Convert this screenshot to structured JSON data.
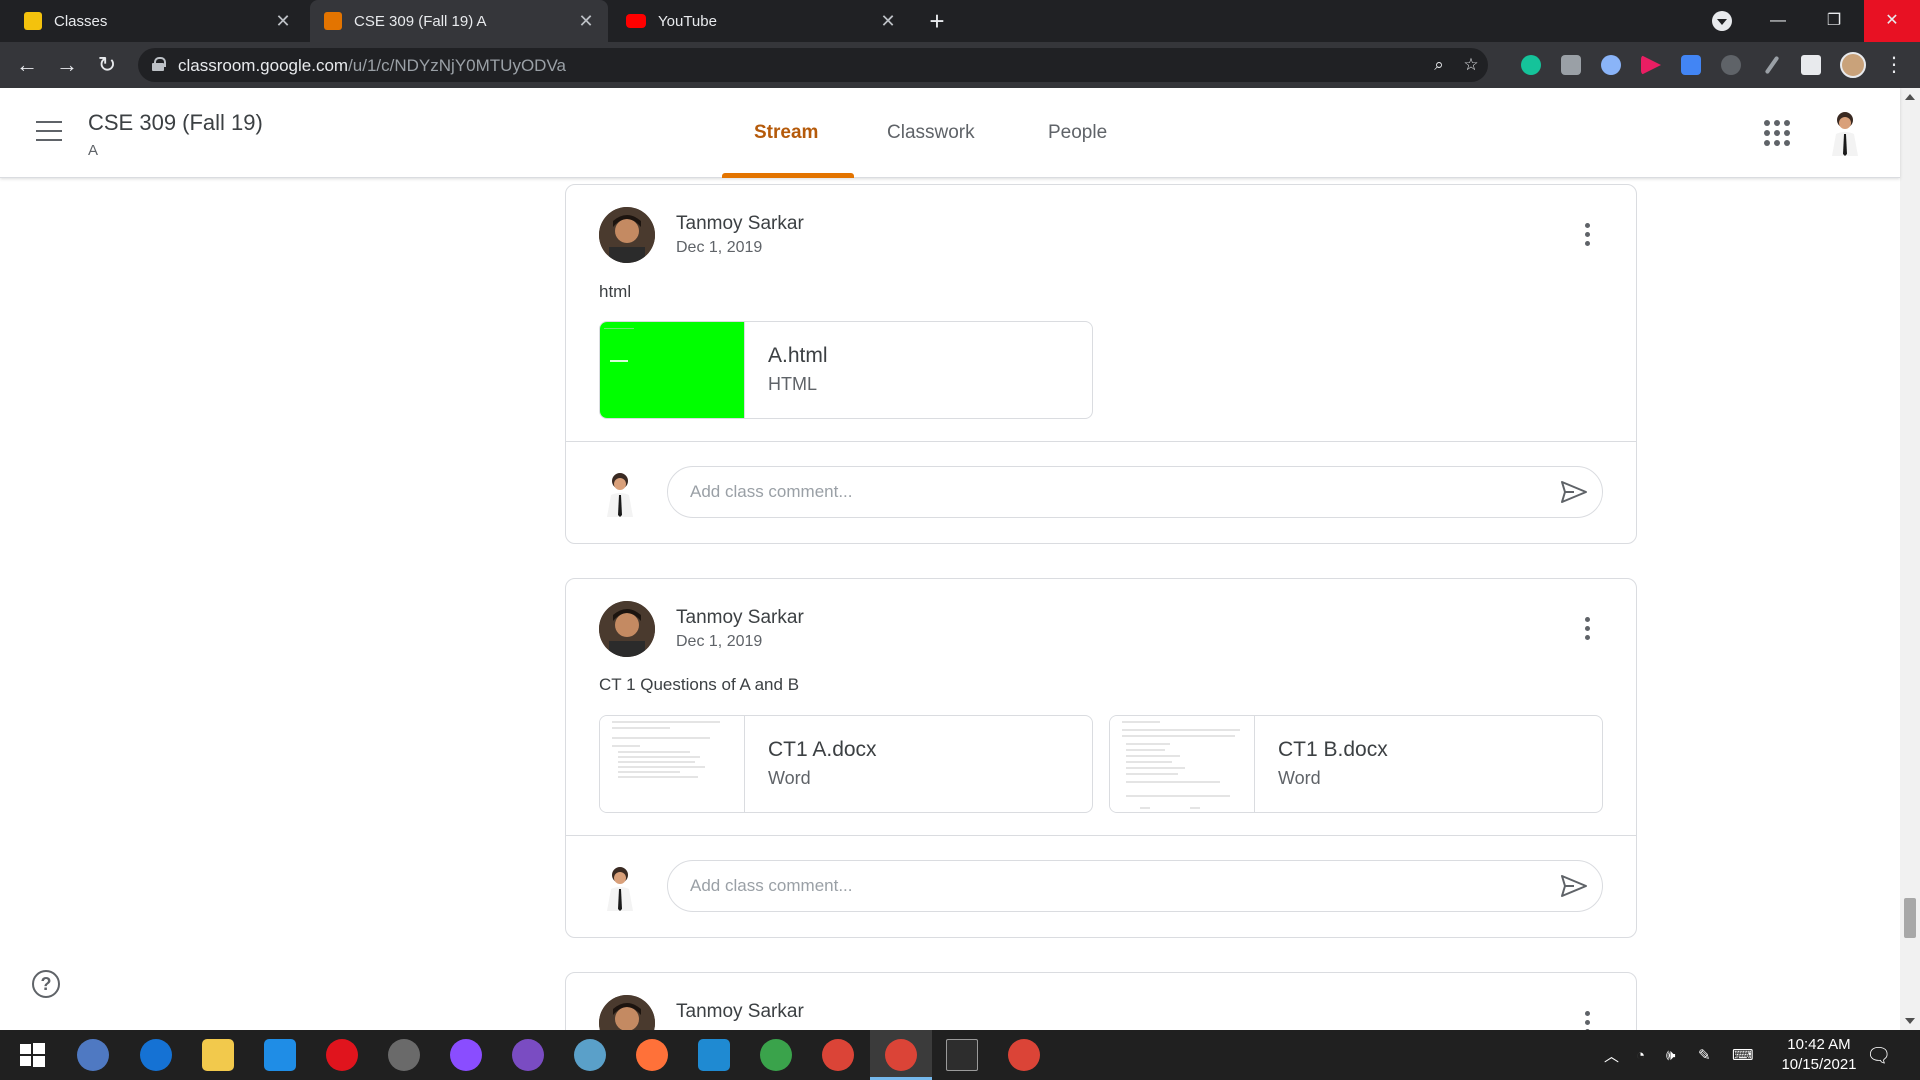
{
  "browser": {
    "tabs": [
      {
        "title": "Classes",
        "active": false,
        "favicon_color": "#f4c20d"
      },
      {
        "title": "CSE 309 (Fall 19) A",
        "active": true,
        "favicon_color": "#e37400"
      },
      {
        "title": "YouTube",
        "active": false,
        "favicon_color": "#ff0000"
      }
    ],
    "url_main": "classroom.google.com",
    "url_path": "/u/1/c/NDYzNjY0MTUyODVa"
  },
  "classroom": {
    "course_title": "CSE 309 (Fall 19)",
    "section": "A",
    "nav_tabs": [
      "Stream",
      "Classwork",
      "People"
    ],
    "active_tab": "Stream",
    "accent_color": "#e37400"
  },
  "posts": [
    {
      "author": "Tanmoy Sarkar",
      "date": "Dec 1, 2019",
      "text": "html",
      "attachments": [
        {
          "name": "A.html",
          "type": "HTML",
          "thumb_color": "#00ff00"
        }
      ],
      "comment_placeholder": "Add class comment..."
    },
    {
      "author": "Tanmoy Sarkar",
      "date": "Dec 1, 2019",
      "text": "CT 1 Questions of A and B",
      "attachments": [
        {
          "name": "CT1 A.docx",
          "type": "Word"
        },
        {
          "name": "CT1 B.docx",
          "type": "Word"
        }
      ],
      "comment_placeholder": "Add class comment..."
    },
    {
      "author": "Tanmoy Sarkar"
    }
  ],
  "taskbar": {
    "time": "10:42 AM",
    "date": "10/15/2021"
  }
}
